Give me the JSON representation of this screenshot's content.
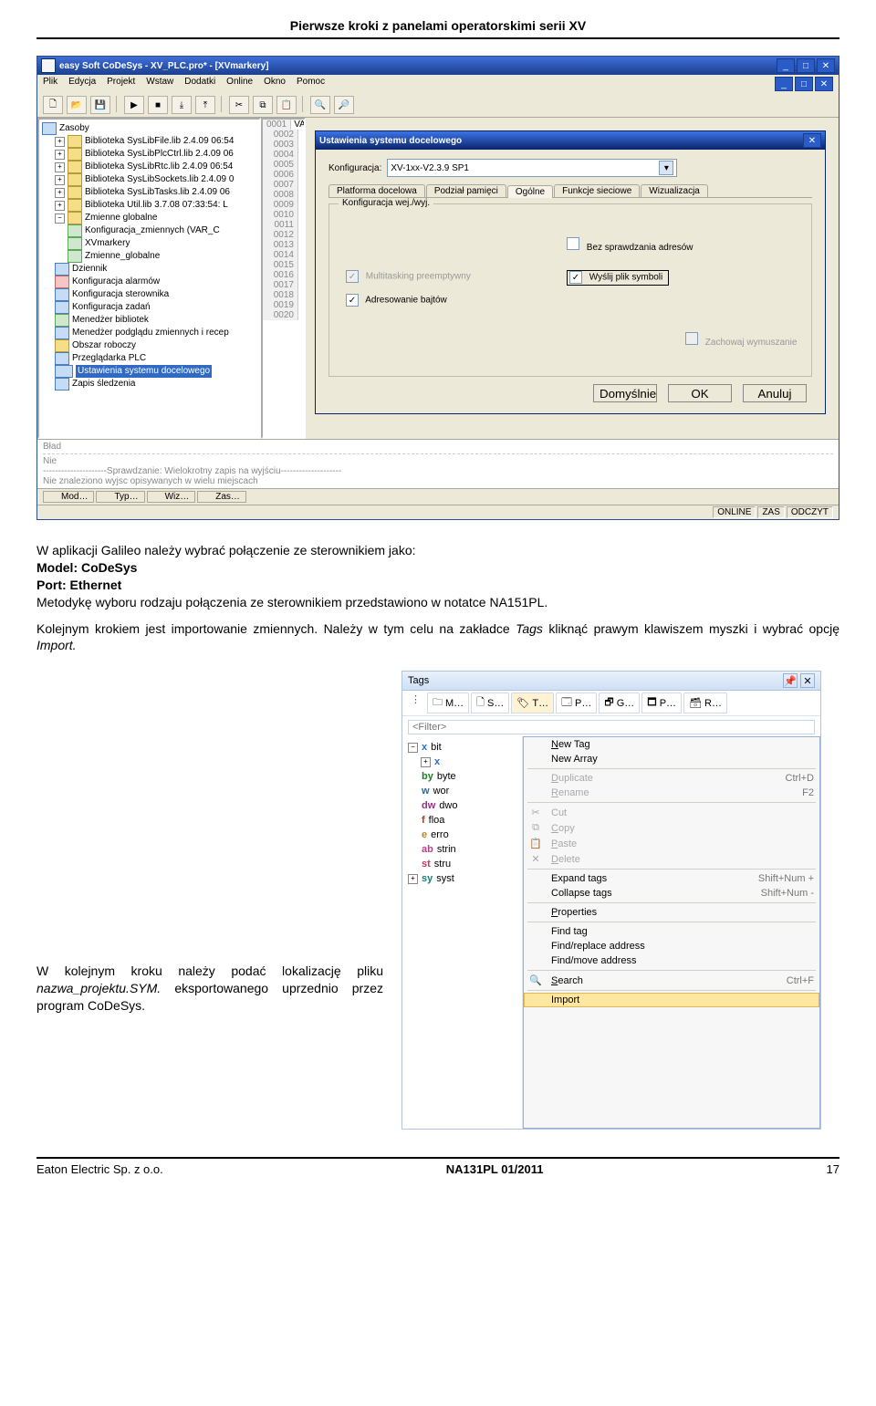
{
  "header": "Pierwsze kroki z panelami operatorskimi serii XV",
  "screenshot1": {
    "title": "easy Soft CoDeSys - XV_PLC.pro* - [XVmarkery]",
    "menu": [
      "Plik",
      "Edycja",
      "Projekt",
      "Wstaw",
      "Dodatki",
      "Online",
      "Okno",
      "Pomoc"
    ],
    "tree": {
      "root": "Zasoby",
      "libs": [
        "Biblioteka SysLibFile.lib 2.4.09 06:54",
        "Biblioteka SysLibPlcCtrl.lib 2.4.09 06",
        "Biblioteka SysLibRtc.lib 2.4.09 06:54",
        "Biblioteka SysLibSockets.lib 2.4.09 0",
        "Biblioteka SysLibTasks.lib 2.4.09 06",
        "Biblioteka Util.lib 3.7.08 07:33:54: L"
      ],
      "globals": "Zmienne globalne",
      "g_items": [
        "Konfiguracja_zmiennych (VAR_C",
        "XVmarkery",
        "Zmienne_globalne"
      ],
      "items": [
        "Dziennik",
        "Konfiguracja alarmów",
        "Konfiguracja sterownika",
        "Konfiguracja zadań",
        "Menedżer bibliotek",
        "Menedżer podglądu zmiennych i recep",
        "Obszar roboczy",
        "Przeglądarka PLC",
        "Ustawienia systemu docelowego",
        "Zapis śledzenia"
      ]
    },
    "code": {
      "line1": "0001",
      "text1": "VAR_GLOBAL",
      "lines": [
        "0002",
        "0003",
        "0004",
        "0005",
        "0006",
        "0007",
        "0008",
        "0009",
        "0010",
        "0011",
        "0012",
        "0013",
        "0014",
        "0015",
        "0016",
        "0017",
        "0018",
        "0019",
        "0020"
      ]
    },
    "dlg": {
      "title": "Ustawienia systemu docelowego",
      "cfg_label": "Konfiguracja:",
      "cfg_value": "XV-1xx-V2.3.9 SP1",
      "tabs": [
        "Platforma docelowa",
        "Podział pamięci",
        "Ogólne",
        "Funkcje sieciowe",
        "Wizualizacja"
      ],
      "gb_title": "Konfiguracja wej./wyj.",
      "cb_noaddr": "Bez sprawdzania adresów",
      "cb_multi": "Multitasking preemptywny",
      "cb_sym": "Wyślij plik symboli",
      "cb_byte": "Adresowanie bajtów",
      "cb_force": "Zachowaj wymuszanie",
      "btns": [
        "Domyślnie",
        "OK",
        "Anuluj"
      ]
    },
    "status1": "Bład",
    "status2": "Nie",
    "msg1": "---------------------Sprawdzanie: Wielokrotny zapis na wyjściu--------------------",
    "msg2": "Nie znaleziono wyjsc opisywanych w wielu miejscach",
    "bottom_tabs": [
      "Mod…",
      "Typ…",
      "Wiz…",
      "Zas…"
    ],
    "statusbar": [
      "ONLINE",
      "ZAS",
      "ODCZYT"
    ]
  },
  "article": {
    "p1a": "W aplikacji Galileo należy wybrać połączenie ze sterownikiem jako:",
    "p1b": "Model: CoDeSys",
    "p1c": "Port: Ethernet",
    "p1d": "Metodykę wyboru rodzaju połączenia ze sterownikiem przedstawiono w notatce NA151PL.",
    "p2": "Kolejnym krokiem jest importowanie zmiennych. Należy w tym celu na zakładce ",
    "p2i": "Tags",
    "p2b": " kliknąć prawym klawiszem myszki i wybrać opcję ",
    "p2ii": "Import.",
    "p3": "W kolejnym kroku należy podać lokalizację pliku ",
    "p3i": "nazwa_projektu.SYM.",
    "p3b": " eksportowanego uprzednio przez program CoDeSys."
  },
  "screenshot2": {
    "panel_title": "Tags",
    "ptabs": [
      "M…",
      "S…",
      "T…",
      "P…",
      "G…",
      "P…",
      "R…"
    ],
    "filter": "<Filter>",
    "types": [
      {
        "sym": "x",
        "cls": "c-x",
        "lbl": "bit"
      },
      {
        "sym": "x",
        "cls": "c-x",
        "lbl": ""
      },
      {
        "sym": "by",
        "cls": "c-by",
        "lbl": "byte"
      },
      {
        "sym": "w",
        "cls": "c-w",
        "lbl": "wor"
      },
      {
        "sym": "dw",
        "cls": "c-dw",
        "lbl": "dwo"
      },
      {
        "sym": "f",
        "cls": "c-f",
        "lbl": "floa"
      },
      {
        "sym": "e",
        "cls": "c-e",
        "lbl": "erro"
      },
      {
        "sym": "ab",
        "cls": "c-ab",
        "lbl": "strin"
      },
      {
        "sym": "st",
        "cls": "c-st",
        "lbl": "stru"
      },
      {
        "sym": "sy",
        "cls": "c-sy",
        "lbl": "syst"
      }
    ],
    "menu": [
      {
        "icon": "",
        "txt": "New Tag",
        "u": "N"
      },
      {
        "icon": "",
        "txt": "New Array"
      },
      {
        "sep": true
      },
      {
        "icon": "",
        "txt": "Duplicate",
        "u": "D",
        "sc": "Ctrl+D",
        "dis": true
      },
      {
        "icon": "",
        "txt": "Rename",
        "u": "R",
        "sc": "F2",
        "dis": true
      },
      {
        "sep": true
      },
      {
        "icon": "✂",
        "txt": "Cut",
        "u": "",
        "dis": true
      },
      {
        "icon": "⧉",
        "txt": "Copy",
        "u": "C",
        "dis": true
      },
      {
        "icon": "📋",
        "txt": "Paste",
        "u": "P",
        "dis": true
      },
      {
        "icon": "✕",
        "txt": "Delete",
        "u": "D",
        "dis": true
      },
      {
        "sep": true
      },
      {
        "icon": "",
        "txt": "Expand tags",
        "sc": "Shift+Num +"
      },
      {
        "icon": "",
        "txt": "Collapse tags",
        "sc": "Shift+Num -"
      },
      {
        "sep": true
      },
      {
        "icon": "",
        "txt": "Properties",
        "u": "P"
      },
      {
        "sep": true
      },
      {
        "icon": "",
        "txt": "Find tag"
      },
      {
        "icon": "",
        "txt": "Find/replace address"
      },
      {
        "icon": "",
        "txt": "Find/move address"
      },
      {
        "sep": true
      },
      {
        "icon": "🔍",
        "txt": "Search",
        "u": "S",
        "sc": "Ctrl+F"
      },
      {
        "sep": true
      },
      {
        "icon": "",
        "txt": "Import",
        "sel": true
      }
    ]
  },
  "footer": {
    "left": "Eaton Electric Sp. z o.o.",
    "center": "NA131PL 01/2011",
    "right": "17"
  }
}
